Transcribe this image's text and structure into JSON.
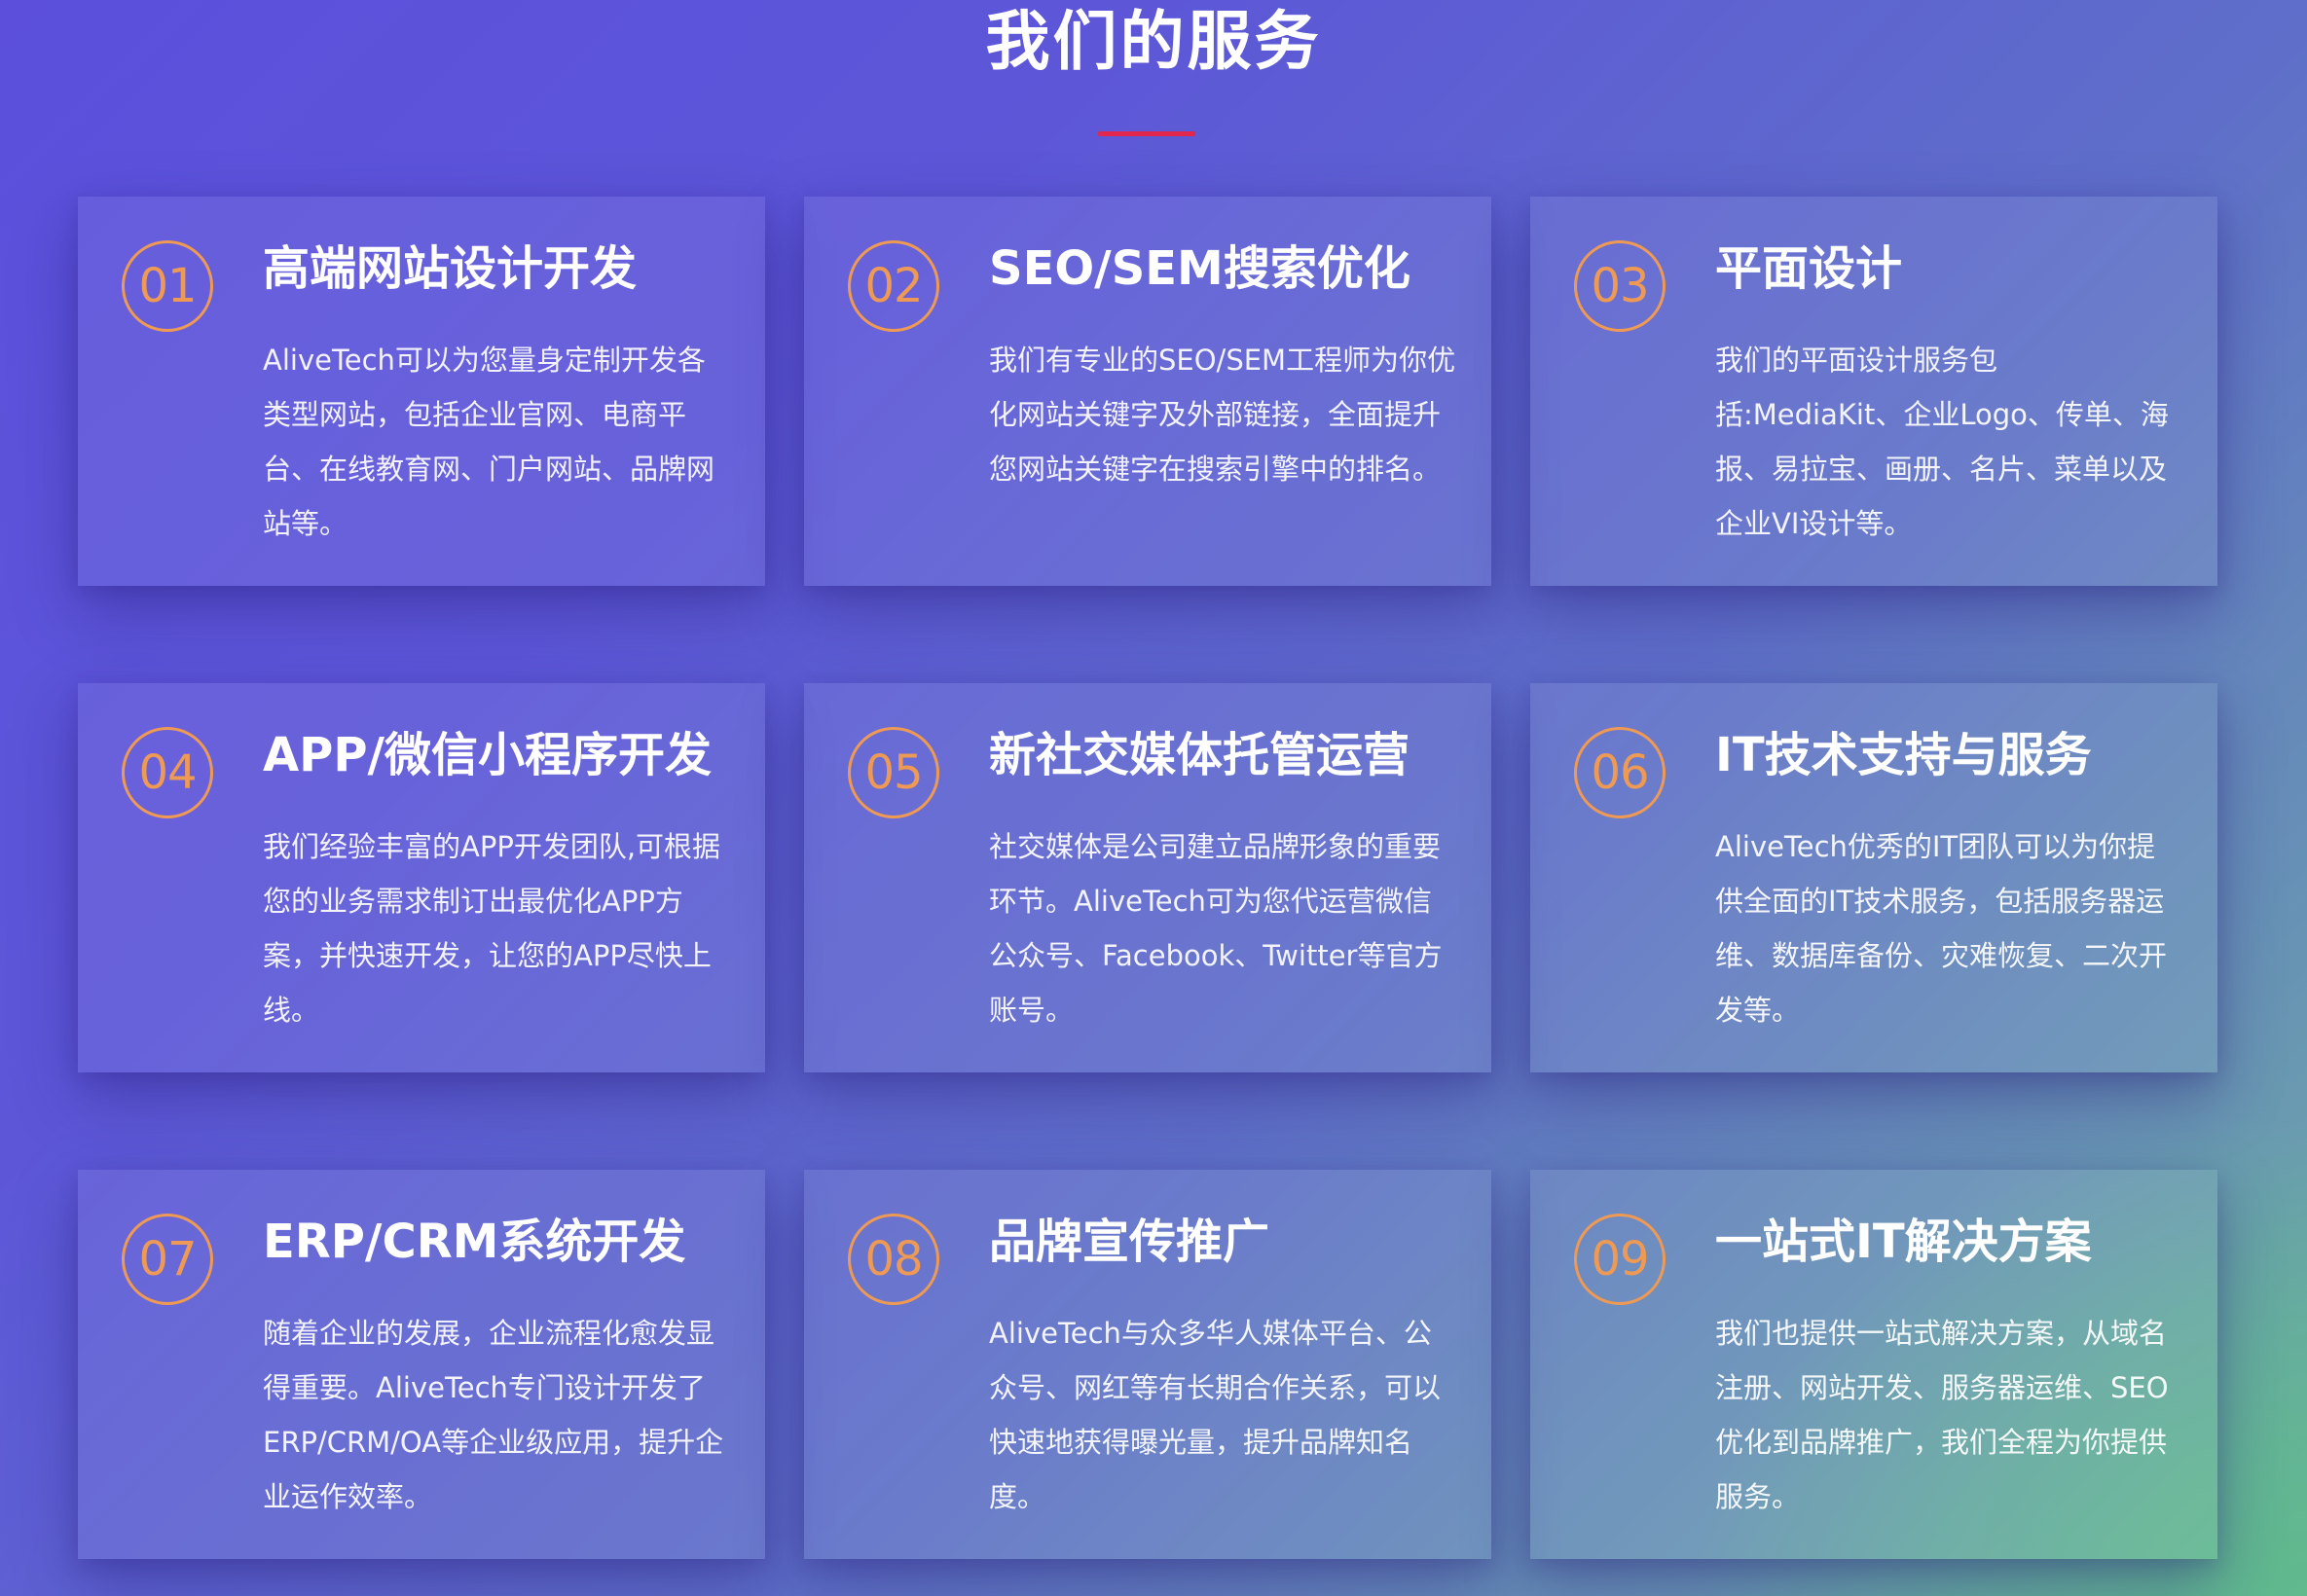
{
  "section": {
    "title": "我们的服务",
    "accent_color": "#e2274f",
    "badge_color": "#ef9a54"
  },
  "services": [
    {
      "number": "01",
      "title": "高端网站设计开发",
      "description": "AliveTech可以为您量身定制开发各类型网站，包括企业官网、电商平台、在线教育网、门户网站、品牌网站等。"
    },
    {
      "number": "02",
      "title": "SEO/SEM搜索优化",
      "description": "我们有专业的SEO/SEM工程师为你优化网站关键字及外部链接，全面提升您网站关键字在搜索引擎中的排名。"
    },
    {
      "number": "03",
      "title": "平面设计",
      "description": "我们的平面设计服务包括:MediaKit、企业Logo、传单、海报、易拉宝、画册、名片、菜单以及企业VI设计等。"
    },
    {
      "number": "04",
      "title": "APP/微信小程序开发",
      "description": "我们经验丰富的APP开发团队,可根据您的业务需求制订出最优化APP方案，并快速开发，让您的APP尽快上线。"
    },
    {
      "number": "05",
      "title": "新社交媒体托管运营",
      "description": "社交媒体是公司建立品牌形象的重要环节。AliveTech可为您代运营微信公众号、Facebook、Twitter等官方账号。"
    },
    {
      "number": "06",
      "title": "IT技术支持与服务",
      "description": "AliveTech优秀的IT团队可以为你提供全面的IT技术服务，包括服务器运维、数据库备份、灾难恢复、二次开发等。"
    },
    {
      "number": "07",
      "title": "ERP/CRM系统开发",
      "description": "随着企业的发展，企业流程化愈发显得重要。AliveTech专门设计开发了ERP/CRM/OA等企业级应用，提升企业运作效率。"
    },
    {
      "number": "08",
      "title": "品牌宣传推广",
      "description": "AliveTech与众多华人媒体平台、公众号、网红等有长期合作关系，可以快速地获得曝光量，提升品牌知名度。"
    },
    {
      "number": "09",
      "title": "一站式IT解决方案",
      "description": "我们也提供一站式解决方案，从域名注册、网站开发、服务器运维、SEO优化到品牌推广，我们全程为你提供服务。"
    }
  ]
}
